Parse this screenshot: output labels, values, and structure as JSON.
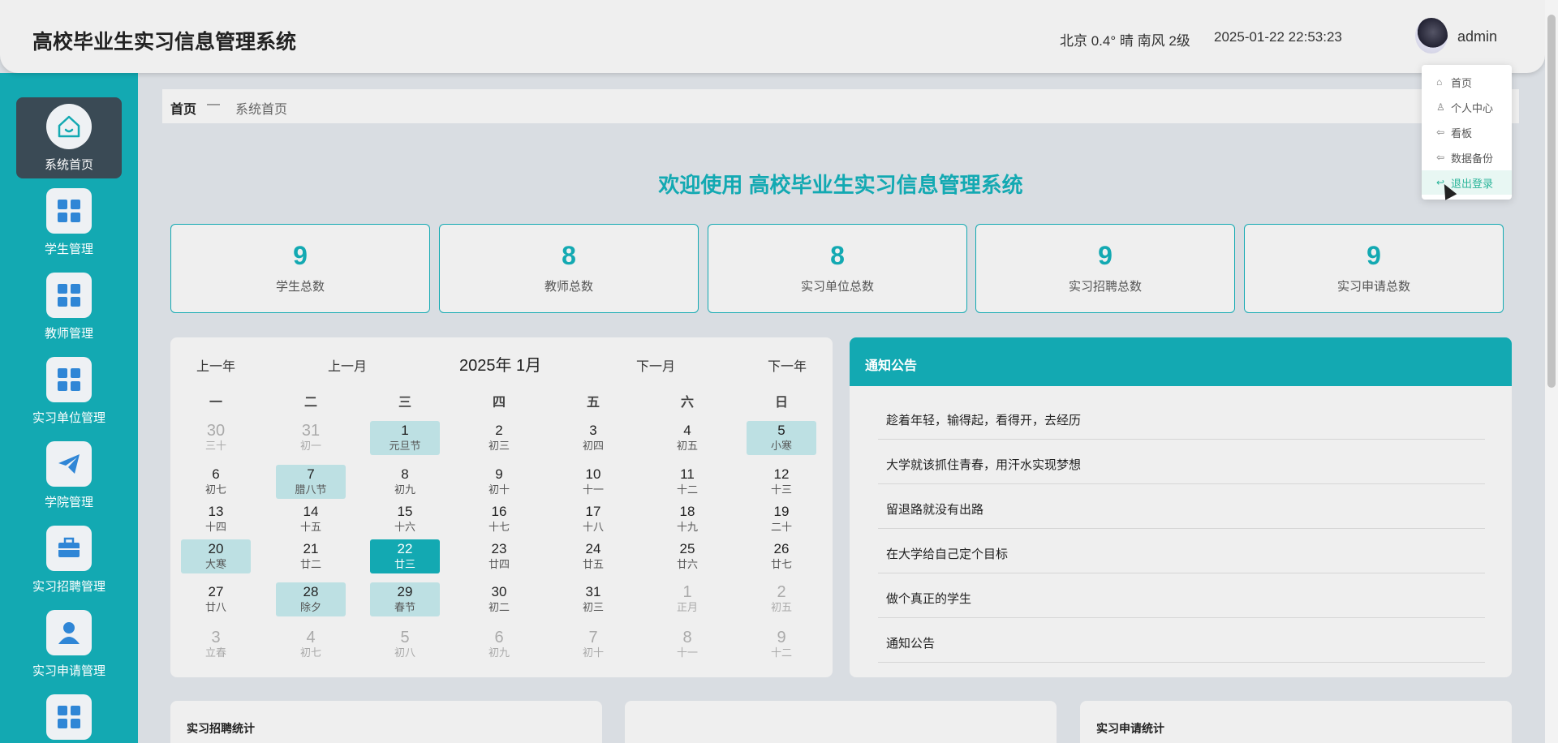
{
  "header": {
    "title": "高校毕业生实习信息管理系统",
    "weather": "北京  0.4°  晴  南风  2级",
    "datetime": "2025-01-22 22:53:23",
    "username": "admin"
  },
  "sidebar": {
    "items": [
      {
        "label": "系统首页",
        "icon": "home-icon"
      },
      {
        "label": "学生管理",
        "icon": "grid-icon"
      },
      {
        "label": "教师管理",
        "icon": "grid-icon"
      },
      {
        "label": "实习单位管理",
        "icon": "grid-icon"
      },
      {
        "label": "学院管理",
        "icon": "paper-plane-icon"
      },
      {
        "label": "实习招聘管理",
        "icon": "briefcase-icon"
      },
      {
        "label": "实习申请管理",
        "icon": "user-icon"
      }
    ]
  },
  "breadcrumb": {
    "home": "首页",
    "separator": "—",
    "page": "系统首页"
  },
  "welcome": "欢迎使用 高校毕业生实习信息管理系统",
  "stats": [
    {
      "value": "9",
      "label": "学生总数"
    },
    {
      "value": "8",
      "label": "教师总数"
    },
    {
      "value": "8",
      "label": "实习单位总数"
    },
    {
      "value": "9",
      "label": "实习招聘总数"
    },
    {
      "value": "9",
      "label": "实习申请总数"
    }
  ],
  "calendar": {
    "prev_year": "上一年",
    "prev_month": "上一月",
    "title": "2025年 1月",
    "next_month": "下一月",
    "next_year": "下一年",
    "weekdays": [
      "一",
      "二",
      "三",
      "四",
      "五",
      "六",
      "日"
    ],
    "weeks": [
      [
        {
          "d": "30",
          "l": "三十",
          "other": true
        },
        {
          "d": "31",
          "l": "初一",
          "other": true
        },
        {
          "d": "1",
          "l": "元旦节",
          "fest": true
        },
        {
          "d": "2",
          "l": "初三"
        },
        {
          "d": "3",
          "l": "初四"
        },
        {
          "d": "4",
          "l": "初五"
        },
        {
          "d": "5",
          "l": "小寒",
          "fest": true
        }
      ],
      [
        {
          "d": "6",
          "l": "初七"
        },
        {
          "d": "7",
          "l": "腊八节",
          "fest": true
        },
        {
          "d": "8",
          "l": "初九"
        },
        {
          "d": "9",
          "l": "初十"
        },
        {
          "d": "10",
          "l": "十一"
        },
        {
          "d": "11",
          "l": "十二"
        },
        {
          "d": "12",
          "l": "十三"
        }
      ],
      [
        {
          "d": "13",
          "l": "十四"
        },
        {
          "d": "14",
          "l": "十五"
        },
        {
          "d": "15",
          "l": "十六"
        },
        {
          "d": "16",
          "l": "十七"
        },
        {
          "d": "17",
          "l": "十八"
        },
        {
          "d": "18",
          "l": "十九"
        },
        {
          "d": "19",
          "l": "二十"
        }
      ],
      [
        {
          "d": "20",
          "l": "大寒",
          "fest": true
        },
        {
          "d": "21",
          "l": "廿二"
        },
        {
          "d": "22",
          "l": "廿三",
          "today": true
        },
        {
          "d": "23",
          "l": "廿四"
        },
        {
          "d": "24",
          "l": "廿五"
        },
        {
          "d": "25",
          "l": "廿六"
        },
        {
          "d": "26",
          "l": "廿七"
        }
      ],
      [
        {
          "d": "27",
          "l": "廿八"
        },
        {
          "d": "28",
          "l": "除夕",
          "fest": true
        },
        {
          "d": "29",
          "l": "春节",
          "fest": true
        },
        {
          "d": "30",
          "l": "初二"
        },
        {
          "d": "31",
          "l": "初三"
        },
        {
          "d": "1",
          "l": "正月",
          "other": true
        },
        {
          "d": "2",
          "l": "初五",
          "other": true
        }
      ],
      [
        {
          "d": "3",
          "l": "立春",
          "other": true
        },
        {
          "d": "4",
          "l": "初七",
          "other": true
        },
        {
          "d": "5",
          "l": "初八",
          "other": true
        },
        {
          "d": "6",
          "l": "初九",
          "other": true
        },
        {
          "d": "7",
          "l": "初十",
          "other": true
        },
        {
          "d": "8",
          "l": "十一",
          "other": true
        },
        {
          "d": "9",
          "l": "十二",
          "other": true
        }
      ]
    ]
  },
  "notice": {
    "title": "通知公告",
    "items": [
      "趁着年轻，输得起，看得开，去经历",
      "大学就该抓住青春，用汗水实现梦想",
      "留退路就没有出路",
      "在大学给自己定个目标",
      "做个真正的学生",
      "通知公告"
    ]
  },
  "bottom": {
    "recruit_stats": "实习招聘统计",
    "apply_stats": "实习申请统计"
  },
  "dropdown": {
    "items": [
      {
        "label": "首页",
        "icon": "home-icon"
      },
      {
        "label": "个人中心",
        "icon": "user-icon"
      },
      {
        "label": "看板",
        "icon": "arrow-left-icon"
      },
      {
        "label": "数据备份",
        "icon": "arrow-left-icon"
      },
      {
        "label": "退出登录",
        "icon": "logout-icon"
      }
    ]
  },
  "colors": {
    "accent": "#13a9b2",
    "sidebar_active": "#3a4a55",
    "festival": "#bde0e3",
    "hover": "#2bb59a"
  }
}
